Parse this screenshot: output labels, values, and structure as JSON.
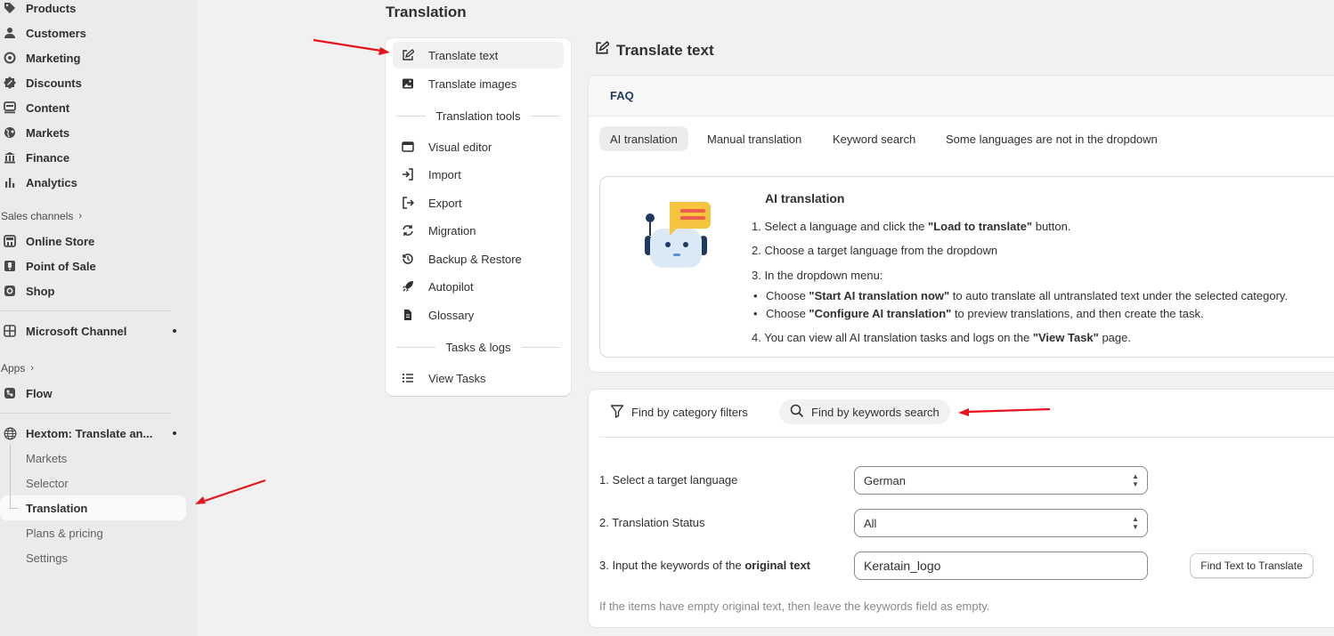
{
  "sidebar": {
    "items": [
      {
        "label": "Products",
        "icon": "tag-icon"
      },
      {
        "label": "Customers",
        "icon": "person-icon"
      },
      {
        "label": "Marketing",
        "icon": "target-icon"
      },
      {
        "label": "Discounts",
        "icon": "discount-icon"
      },
      {
        "label": "Content",
        "icon": "content-icon"
      },
      {
        "label": "Markets",
        "icon": "globe-icon"
      },
      {
        "label": "Finance",
        "icon": "bank-icon"
      },
      {
        "label": "Analytics",
        "icon": "bar-chart-icon"
      }
    ],
    "sales_channels_header": "Sales channels",
    "channels": [
      {
        "label": "Online Store",
        "icon": "store-icon"
      },
      {
        "label": "Point of Sale",
        "icon": "pos-icon"
      },
      {
        "label": "Shop",
        "icon": "shop-icon"
      }
    ],
    "microsoft_channel": "Microsoft Channel",
    "apps_header": "Apps",
    "flow": "Flow",
    "app_name": "Hextom: Translate an...",
    "app_subitems": [
      "Markets",
      "Selector",
      "Translation",
      "Plans & pricing",
      "Settings"
    ]
  },
  "page": {
    "title": "Translation"
  },
  "menu": {
    "translate_text": "Translate text",
    "translate_images": "Translate images",
    "tools_header": "Translation tools",
    "tools": [
      "Visual editor",
      "Import",
      "Export",
      "Migration",
      "Backup & Restore",
      "Autopilot",
      "Glossary"
    ],
    "tasks_header": "Tasks & logs",
    "view_tasks": "View Tasks"
  },
  "main": {
    "section_title": "Translate text",
    "faq_label": "FAQ",
    "tabs": [
      "AI translation",
      "Manual translation",
      "Keyword search",
      "Some languages are not in the dropdown"
    ],
    "ai": {
      "title": "AI translation",
      "step1_pre": "1. Select a language and click the ",
      "step1_bold": "\"Load to translate\"",
      "step1_post": " button.",
      "step2": "2. Choose a target language from the dropdown",
      "step3": "3. In the dropdown menu:",
      "bullet1_pre": "Choose ",
      "bullet1_bold": "\"Start AI translation now\"",
      "bullet1_post": " to auto translate all untranslated text under the selected category.",
      "bullet2_pre": "Choose ",
      "bullet2_bold": "\"Configure AI translation\"",
      "bullet2_post": " to preview translations, and then create the task.",
      "step4_pre": "4. You can view all AI translation tasks and logs on the ",
      "step4_bold": "\"View Task\"",
      "step4_post": " page."
    },
    "search": {
      "filter_category": "Find by category filters",
      "filter_keywords": "Find by keywords search",
      "row1_label": "1. Select a target language",
      "row1_value": "German",
      "row2_label": "2. Translation Status",
      "row2_value": "All",
      "row3_label_pre": "3. Input the keywords of the ",
      "row3_label_bold": "original text",
      "row3_value": "Keratain_logo",
      "find_button": "Find Text to Translate",
      "hint": "If the items have empty original text, then leave the keywords field as empty."
    }
  },
  "colors": {
    "arrow": "#e8141b",
    "robot_face": "#dbe9f7",
    "robot_dark": "#1e3a5f",
    "bubble": "#f7c43f"
  }
}
